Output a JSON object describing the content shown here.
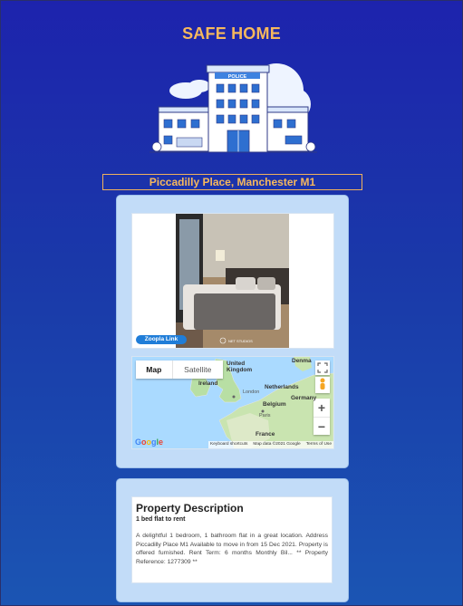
{
  "header": {
    "title": "SAFE HOME"
  },
  "hero": {
    "building_sign": "POLICE"
  },
  "address": "Piccadilly Place, Manchester M1",
  "listing": {
    "photo_link_label": "Zoopla Link",
    "photo_watermark": "NET STUDIOS"
  },
  "map": {
    "tabs": [
      "Map",
      "Satellite"
    ],
    "labels": {
      "denmark": "Denma",
      "uk": "United\nKingdom",
      "ireland": "Ireland",
      "netherlands": "Netherlands",
      "belgium": "Belgium",
      "germany": "Germany",
      "france": "France",
      "london": "London",
      "paris": "Paris"
    },
    "zoom_in": "+",
    "zoom_out": "−",
    "google_logo": "Google",
    "footer": [
      "Keyboard shortcuts",
      "Map data ©2021 Google",
      "Terms of Use"
    ]
  },
  "description": {
    "title": "Property Description",
    "subtitle": "1 bed flat to rent",
    "body": "A delightful 1 bedroom, 1 bathroom flat in a great location. Address Piccadilly Place M1 Available to move in from 15 Dec 2021. Property is offered furnished. Rent Term: 6 months Monthly Bil... ** Property Reference: 1277309 **"
  },
  "colors": {
    "accent": "#f6b85d",
    "card_bg": "#c2dcf8",
    "background_top": "#1d23ad",
    "background_bottom": "#1b55b3"
  }
}
